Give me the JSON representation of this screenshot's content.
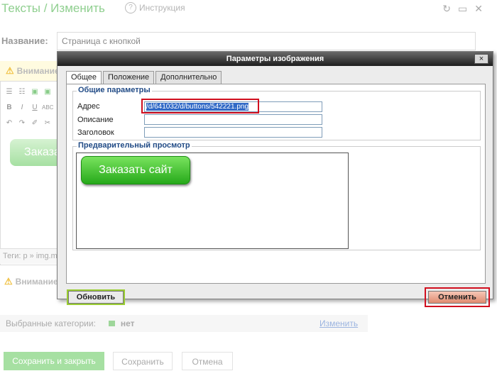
{
  "page": {
    "title": "Тексты / Изменить",
    "help_label": "Инструкция",
    "name_label": "Название:",
    "name_value": "Страница с кнопкой",
    "warning_label": "Внимание",
    "warning_label_2": "Внимание",
    "editor_button_text": "Заказа",
    "tags_text": "Теги: p » img.m",
    "categories_label": "Выбранные категории:",
    "categories_value": "нет",
    "categories_change": "Изменить",
    "save_close": "Сохранить и закрыть",
    "save": "Сохранить",
    "cancel": "Отмена"
  },
  "dialog": {
    "title": "Параметры изображения",
    "close_label": "×",
    "tabs": [
      {
        "label": "Общее"
      },
      {
        "label": "Положение"
      },
      {
        "label": "Дополнительно"
      }
    ],
    "general_legend": "Общие параметры",
    "fields": {
      "address_label": "Адрес",
      "address_value": "/d/641032/d/buttons/542221.png",
      "description_label": "Описание",
      "description_value": "",
      "title_label": "Заголовок",
      "title_value": ""
    },
    "preview_legend": "Предварительный просмотр",
    "preview_button": "Заказать сайт",
    "update_button": "Обновить",
    "cancel_button": "Отменить"
  },
  "colors": {
    "accent_green": "#a6e0a2",
    "highlight_red": "#d10f1f",
    "legend_blue": "#214b86"
  }
}
